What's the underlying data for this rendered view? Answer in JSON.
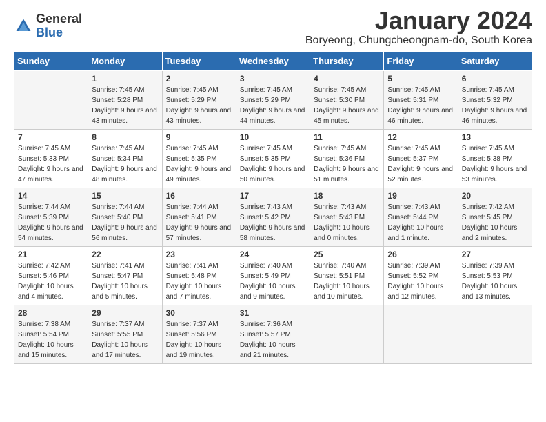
{
  "logo": {
    "general": "General",
    "blue": "Blue"
  },
  "title": "January 2024",
  "location": "Boryeong, Chungcheongnam-do, South Korea",
  "days_of_week": [
    "Sunday",
    "Monday",
    "Tuesday",
    "Wednesday",
    "Thursday",
    "Friday",
    "Saturday"
  ],
  "weeks": [
    [
      {
        "day": "",
        "sunrise": "",
        "sunset": "",
        "daylight": ""
      },
      {
        "day": "1",
        "sunrise": "Sunrise: 7:45 AM",
        "sunset": "Sunset: 5:28 PM",
        "daylight": "Daylight: 9 hours and 43 minutes."
      },
      {
        "day": "2",
        "sunrise": "Sunrise: 7:45 AM",
        "sunset": "Sunset: 5:29 PM",
        "daylight": "Daylight: 9 hours and 43 minutes."
      },
      {
        "day": "3",
        "sunrise": "Sunrise: 7:45 AM",
        "sunset": "Sunset: 5:29 PM",
        "daylight": "Daylight: 9 hours and 44 minutes."
      },
      {
        "day": "4",
        "sunrise": "Sunrise: 7:45 AM",
        "sunset": "Sunset: 5:30 PM",
        "daylight": "Daylight: 9 hours and 45 minutes."
      },
      {
        "day": "5",
        "sunrise": "Sunrise: 7:45 AM",
        "sunset": "Sunset: 5:31 PM",
        "daylight": "Daylight: 9 hours and 46 minutes."
      },
      {
        "day": "6",
        "sunrise": "Sunrise: 7:45 AM",
        "sunset": "Sunset: 5:32 PM",
        "daylight": "Daylight: 9 hours and 46 minutes."
      }
    ],
    [
      {
        "day": "7",
        "sunrise": "Sunrise: 7:45 AM",
        "sunset": "Sunset: 5:33 PM",
        "daylight": "Daylight: 9 hours and 47 minutes."
      },
      {
        "day": "8",
        "sunrise": "Sunrise: 7:45 AM",
        "sunset": "Sunset: 5:34 PM",
        "daylight": "Daylight: 9 hours and 48 minutes."
      },
      {
        "day": "9",
        "sunrise": "Sunrise: 7:45 AM",
        "sunset": "Sunset: 5:35 PM",
        "daylight": "Daylight: 9 hours and 49 minutes."
      },
      {
        "day": "10",
        "sunrise": "Sunrise: 7:45 AM",
        "sunset": "Sunset: 5:35 PM",
        "daylight": "Daylight: 9 hours and 50 minutes."
      },
      {
        "day": "11",
        "sunrise": "Sunrise: 7:45 AM",
        "sunset": "Sunset: 5:36 PM",
        "daylight": "Daylight: 9 hours and 51 minutes."
      },
      {
        "day": "12",
        "sunrise": "Sunrise: 7:45 AM",
        "sunset": "Sunset: 5:37 PM",
        "daylight": "Daylight: 9 hours and 52 minutes."
      },
      {
        "day": "13",
        "sunrise": "Sunrise: 7:45 AM",
        "sunset": "Sunset: 5:38 PM",
        "daylight": "Daylight: 9 hours and 53 minutes."
      }
    ],
    [
      {
        "day": "14",
        "sunrise": "Sunrise: 7:44 AM",
        "sunset": "Sunset: 5:39 PM",
        "daylight": "Daylight: 9 hours and 54 minutes."
      },
      {
        "day": "15",
        "sunrise": "Sunrise: 7:44 AM",
        "sunset": "Sunset: 5:40 PM",
        "daylight": "Daylight: 9 hours and 56 minutes."
      },
      {
        "day": "16",
        "sunrise": "Sunrise: 7:44 AM",
        "sunset": "Sunset: 5:41 PM",
        "daylight": "Daylight: 9 hours and 57 minutes."
      },
      {
        "day": "17",
        "sunrise": "Sunrise: 7:43 AM",
        "sunset": "Sunset: 5:42 PM",
        "daylight": "Daylight: 9 hours and 58 minutes."
      },
      {
        "day": "18",
        "sunrise": "Sunrise: 7:43 AM",
        "sunset": "Sunset: 5:43 PM",
        "daylight": "Daylight: 10 hours and 0 minutes."
      },
      {
        "day": "19",
        "sunrise": "Sunrise: 7:43 AM",
        "sunset": "Sunset: 5:44 PM",
        "daylight": "Daylight: 10 hours and 1 minute."
      },
      {
        "day": "20",
        "sunrise": "Sunrise: 7:42 AM",
        "sunset": "Sunset: 5:45 PM",
        "daylight": "Daylight: 10 hours and 2 minutes."
      }
    ],
    [
      {
        "day": "21",
        "sunrise": "Sunrise: 7:42 AM",
        "sunset": "Sunset: 5:46 PM",
        "daylight": "Daylight: 10 hours and 4 minutes."
      },
      {
        "day": "22",
        "sunrise": "Sunrise: 7:41 AM",
        "sunset": "Sunset: 5:47 PM",
        "daylight": "Daylight: 10 hours and 5 minutes."
      },
      {
        "day": "23",
        "sunrise": "Sunrise: 7:41 AM",
        "sunset": "Sunset: 5:48 PM",
        "daylight": "Daylight: 10 hours and 7 minutes."
      },
      {
        "day": "24",
        "sunrise": "Sunrise: 7:40 AM",
        "sunset": "Sunset: 5:49 PM",
        "daylight": "Daylight: 10 hours and 9 minutes."
      },
      {
        "day": "25",
        "sunrise": "Sunrise: 7:40 AM",
        "sunset": "Sunset: 5:51 PM",
        "daylight": "Daylight: 10 hours and 10 minutes."
      },
      {
        "day": "26",
        "sunrise": "Sunrise: 7:39 AM",
        "sunset": "Sunset: 5:52 PM",
        "daylight": "Daylight: 10 hours and 12 minutes."
      },
      {
        "day": "27",
        "sunrise": "Sunrise: 7:39 AM",
        "sunset": "Sunset: 5:53 PM",
        "daylight": "Daylight: 10 hours and 13 minutes."
      }
    ],
    [
      {
        "day": "28",
        "sunrise": "Sunrise: 7:38 AM",
        "sunset": "Sunset: 5:54 PM",
        "daylight": "Daylight: 10 hours and 15 minutes."
      },
      {
        "day": "29",
        "sunrise": "Sunrise: 7:37 AM",
        "sunset": "Sunset: 5:55 PM",
        "daylight": "Daylight: 10 hours and 17 minutes."
      },
      {
        "day": "30",
        "sunrise": "Sunrise: 7:37 AM",
        "sunset": "Sunset: 5:56 PM",
        "daylight": "Daylight: 10 hours and 19 minutes."
      },
      {
        "day": "31",
        "sunrise": "Sunrise: 7:36 AM",
        "sunset": "Sunset: 5:57 PM",
        "daylight": "Daylight: 10 hours and 21 minutes."
      },
      {
        "day": "",
        "sunrise": "",
        "sunset": "",
        "daylight": ""
      },
      {
        "day": "",
        "sunrise": "",
        "sunset": "",
        "daylight": ""
      },
      {
        "day": "",
        "sunrise": "",
        "sunset": "",
        "daylight": ""
      }
    ]
  ]
}
